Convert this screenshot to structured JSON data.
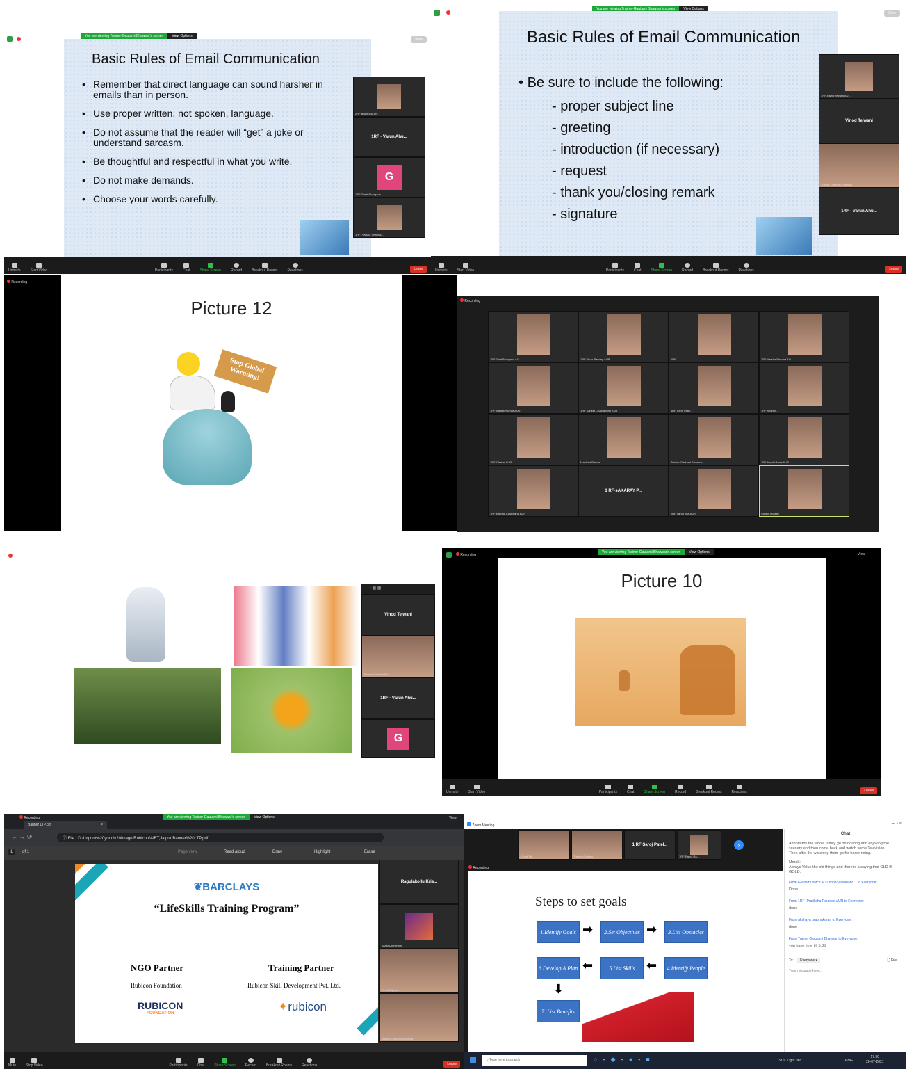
{
  "panel1": {
    "banner": "You are viewing Trainer-Gautami Bhawsar's screen",
    "view_options": "View Options",
    "view_btn": "View",
    "slide_title": "Basic Rules of Email Communication",
    "rules": [
      "Remember that direct language can sound harsher in emails than in person.",
      "Use proper written, not spoken, language.",
      "Do not assume that the reader will “get” a joke or understand sarcasm.",
      "Be thoughtful and respectful in what you write.",
      "Do not make demands.",
      "Choose your words carefully."
    ],
    "participants": [
      {
        "name": "2RF BADRINATH..."
      },
      {
        "name": "1RF - Varun Ahu..."
      },
      {
        "name": "1RF Garal Bhargava..."
      },
      {
        "name": "1RF- Varsha Sharma..."
      }
    ],
    "avatar_letter": "G",
    "toolbar": {
      "unmute": "Unmute",
      "start_video": "Start Video",
      "participants": "Participants",
      "participant_count": "19",
      "chat": "Chat",
      "share": "Share Screen",
      "record": "Record",
      "breakout": "Breakout Rooms",
      "reactions": "Reactions",
      "leave": "Leave"
    }
  },
  "panel2": {
    "banner": "You are viewing Trainer-Gautami Bhawsar's screen",
    "view_options": "View Options",
    "view_btn": "View",
    "slide_title": "Basic Rules of Email Communication",
    "intro": "Be sure to include the following:",
    "items": [
      "- proper subject line",
      "- greeting",
      "- introduction (if necessary)",
      "- request",
      "- thank you/closing remark",
      "- signature"
    ],
    "participants": [
      {
        "name": "1RF-Rahul Ranjan AU..."
      },
      {
        "name": "Vinod Tejwani"
      },
      {
        "name": "Trainer-Gautami Bhawsar"
      },
      {
        "name": "1RF - Varun Ahu..."
      }
    ],
    "toolbar": {
      "unmute": "Unmute",
      "start_video": "Start Video",
      "participants": "Participants",
      "participant_count": "19",
      "chat": "Chat",
      "share": "Share Screen",
      "record": "Record",
      "breakout": "Breakout Rooms",
      "reactions": "Reactions",
      "leave": "Leave"
    }
  },
  "panel3": {
    "recording": "Recording",
    "slide_title": "Picture 12",
    "sign_text": "Stop Global Warming!"
  },
  "panel4": {
    "recording": "Recording",
    "grid": [
      "1RF Gazi Bhargava AU...",
      "1RF Vikas Pandey AUR",
      "1RF...",
      "1RF Varsha Sharma AU...",
      "1RF Santan Kumar AUR",
      "1RF Sanket Chakraborty AUR",
      "1RF Saroj Patel...",
      "1RF Simran...",
      "1RF-Chahat AUR",
      "Manisha Parnar...",
      "Trainer-Gautami Bhawsar",
      "1RF Ayushi Anna AUR",
      "1RF Kashita Kushwaha AUR",
      "1 RF-sAKARAY P...",
      "2RF Varun Jha AUR",
      "Studio Shastry"
    ]
  },
  "panel5": {
    "participants": [
      {
        "name": "Vinod Tejwani"
      },
      {
        "name": "Trainer-Gautami Bha..."
      },
      {
        "name": "1RF - Varun Ahu..."
      }
    ],
    "avatar_letter": "G"
  },
  "panel6": {
    "recording": "Recording",
    "banner": "You are viewing Trainer-Gautami Bhawsar's screen",
    "view_options": "View Options",
    "view_btn": "View",
    "slide_title": "Picture 10",
    "toolbar": {
      "unmute": "Unmute",
      "start_video": "Start Video",
      "participants": "Participants",
      "participant_count": "19",
      "chat": "Chat",
      "share": "Share Screen",
      "record": "Record",
      "breakout": "Breakout Rooms",
      "reactions": "Reactions",
      "leave": "Leave"
    }
  },
  "panel7": {
    "recording": "Recording",
    "tab_title": "Banner LTP.pdf",
    "banner": "You are viewing Trainer-Gautami Bhawsar's screen",
    "view_options": "View Options",
    "view_btn": "View",
    "address": "D:/Imprint%20your%20Image/Rubicon/AIET,Jaipur/Banner%20LTP.pdf",
    "file_label": "File",
    "page": "1",
    "of_pages": "of 1",
    "pdf_tools": {
      "page_view": "Page view",
      "read_aloud": "Read aloud",
      "draw": "Draw",
      "highlight": "Highlight",
      "erase": "Erase"
    },
    "brand": "BARCLAYS",
    "program": "“LifeSkills Training Program”",
    "ngo_heading": "NGO Partner",
    "ngo_name": "Rubicon Foundation",
    "ngo_logo": "RUBICON",
    "ngo_logo_sub": "FOUNDATION",
    "training_heading": "Training Partner",
    "training_name": "Rubicon Skill Development Pvt. Ltd.",
    "training_logo": "rubicon",
    "participants": [
      {
        "name": "Ragulakollu Kris..."
      },
      {
        "name": "TAMADA KIRAN"
      },
      {
        "name": "Vinod Tejwani"
      },
      {
        "name": "Trainer-Gautami Bhawsar"
      }
    ],
    "toolbar": {
      "mute": "Mute",
      "stop_video": "Stop Video",
      "participants": "Participants",
      "participant_count": "24",
      "chat": "Chat",
      "share": "Share Screen",
      "record": "Record",
      "breakout": "Breakout Rooms",
      "reactions": "Reactions",
      "leave": "Leave"
    }
  },
  "panel8": {
    "window_title": "Zoom Meeting",
    "recording": "Recording",
    "top_tiles": [
      {
        "name": "Vinod Tej..."
      },
      {
        "name": "Trainer-Gautam..."
      },
      {
        "name": "1 RF Saroj Patel..."
      },
      {
        "name": "1RF-Rahul Ra..."
      }
    ],
    "slide_title": "Steps to set goals",
    "steps": [
      "1.Identify Goals",
      "2.Set Objectives",
      "3.List Obstacles",
      "6.Develop A Plan",
      "5.List Skills",
      "4.Identify People",
      "7. List Benefits"
    ],
    "chat": {
      "title": "Chat",
      "story": "Afterwards the whole family go on boating and enjoying the scenary and then come back and watch some Television.\nThen after the watching them go for horse riding.",
      "moral_label": "Moral :-",
      "moral": "Always Value the old things and there is a saying that OLD IS GOLD.",
      "messages": [
        {
          "from": "From Gautami batch AU1 sona Vinilanand... to Everyone:",
          "text": "Done"
        },
        {
          "from": "From 1RF- Pratiksha Parande AUR to Everyone:",
          "text": "done"
        },
        {
          "from": "From akshaya prabhakaran to Everyone:",
          "text": "done"
        },
        {
          "from": "From Trainer-Gautami Bhawsar to Everyone:",
          "text": "you have time till 5.35"
        }
      ],
      "to_label": "To:",
      "to_value": "Everyone",
      "file_label": "File",
      "placeholder": "Type message here..."
    },
    "taskbar": {
      "search": "Type here to search",
      "weather": "31°C Light rain",
      "lang": "ENG",
      "time": "17:30",
      "date": "28-07-2021"
    }
  }
}
